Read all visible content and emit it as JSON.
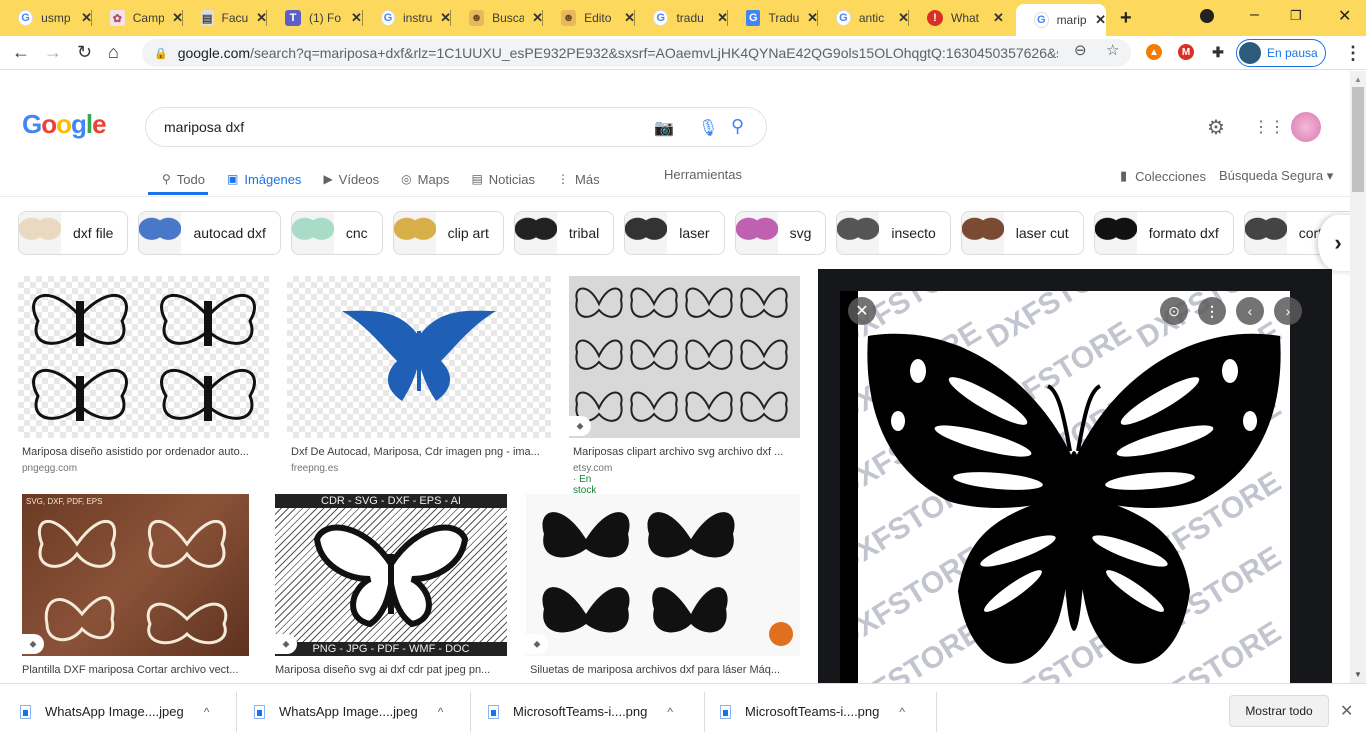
{
  "browser": {
    "tabs": [
      {
        "title": "usmp",
        "favicon": "google-icon",
        "active": false
      },
      {
        "title": "Camp",
        "favicon": "campus-icon",
        "active": false
      },
      {
        "title": "Facul",
        "favicon": "faculty-icon",
        "active": false
      },
      {
        "title": "(1) Fo",
        "favicon": "teams-icon",
        "active": false
      },
      {
        "title": "instru",
        "favicon": "google-icon",
        "active": false
      },
      {
        "title": "Busca",
        "favicon": "busca-icon",
        "active": false
      },
      {
        "title": "Edito",
        "favicon": "editor-icon",
        "active": false
      },
      {
        "title": "tradu",
        "favicon": "google-icon",
        "active": false
      },
      {
        "title": "Tradu",
        "favicon": "translate-icon",
        "active": false
      },
      {
        "title": "antic",
        "favicon": "google-icon",
        "active": false
      },
      {
        "title": "What",
        "favicon": "alert-icon",
        "active": false
      },
      {
        "title": "marip",
        "favicon": "google-icon",
        "active": true
      }
    ],
    "new_tab": "+",
    "address": {
      "domain": "google.com",
      "path": "/search?q=mariposa+dxf&rlz=1C1UUXU_esPE932PE932&sxsrf=AOaemvLjHK4QYNaE42QG9ols15OLOhqgtQ:1630450357626&s..."
    },
    "profile_label": "En pausa"
  },
  "google": {
    "logo_text": "Google",
    "query": "mariposa dxf",
    "nav_tabs": [
      {
        "label": "Todo",
        "icon": "search-icon",
        "active": false
      },
      {
        "label": "Imágenes",
        "icon": "image-icon",
        "active": true
      },
      {
        "label": "Vídeos",
        "icon": "play-icon",
        "active": false
      },
      {
        "label": "Maps",
        "icon": "pin-icon",
        "active": false
      },
      {
        "label": "Noticias",
        "icon": "news-icon",
        "active": false
      },
      {
        "label": "Más",
        "icon": "more-icon",
        "active": false
      }
    ],
    "tools_label": "Herramientas",
    "collections_label": "Colecciones",
    "safe_search_label": "Búsqueda Segura ▾",
    "chips": [
      {
        "label": "dxf file",
        "color": "#e8d9c0"
      },
      {
        "label": "autocad dxf",
        "color": "#4a78c8"
      },
      {
        "label": "cnc",
        "color": "#a8dcc8"
      },
      {
        "label": "clip art",
        "color": "#d8b04a"
      },
      {
        "label": "tribal",
        "color": "#222222"
      },
      {
        "label": "laser",
        "color": "#333333"
      },
      {
        "label": "svg",
        "color": "#c060b0"
      },
      {
        "label": "insecto",
        "color": "#555555"
      },
      {
        "label": "laser cut",
        "color": "#7a4a32"
      },
      {
        "label": "formato dxf",
        "color": "#111111"
      },
      {
        "label": "corte láser",
        "color": "#444444"
      }
    ],
    "results": [
      {
        "caption": "Mariposa diseño asistido por ordenador auto...",
        "source": "pngegg.com",
        "stock": ""
      },
      {
        "caption": "Dxf De Autocad, Mariposa, Cdr imagen png - ima...",
        "source": "freepng.es",
        "stock": ""
      },
      {
        "caption": "Mariposas clipart archivo svg archivo dxf ...",
        "source": "etsy.com · ",
        "stock": "En stock"
      },
      {
        "caption": "Plantilla DXF mariposa Cortar archivo vect...",
        "source": "",
        "stock": ""
      },
      {
        "caption": "Mariposa diseño svg ai dxf cdr pat jpeg pn...",
        "source": "",
        "stock": ""
      },
      {
        "caption": "Siluetas de mariposa archivos dxf para láser Máq...",
        "source": "",
        "stock": ""
      }
    ],
    "image_overlays": {
      "r4_top": "SVG, DXF, PDF, EPS",
      "r5_top": "CDR - SVG - DXF - EPS - AI",
      "r5_bottom": "PNG - JPG - PDF - WMF - DOC"
    },
    "preview": {
      "watermark": "DXFSTORE"
    }
  },
  "downloads": {
    "items": [
      {
        "name": "WhatsApp Image....jpeg"
      },
      {
        "name": "WhatsApp Image....jpeg"
      },
      {
        "name": "MicrosoftTeams-i....png"
      },
      {
        "name": "MicrosoftTeams-i....png"
      }
    ],
    "show_all": "Mostrar todo"
  }
}
